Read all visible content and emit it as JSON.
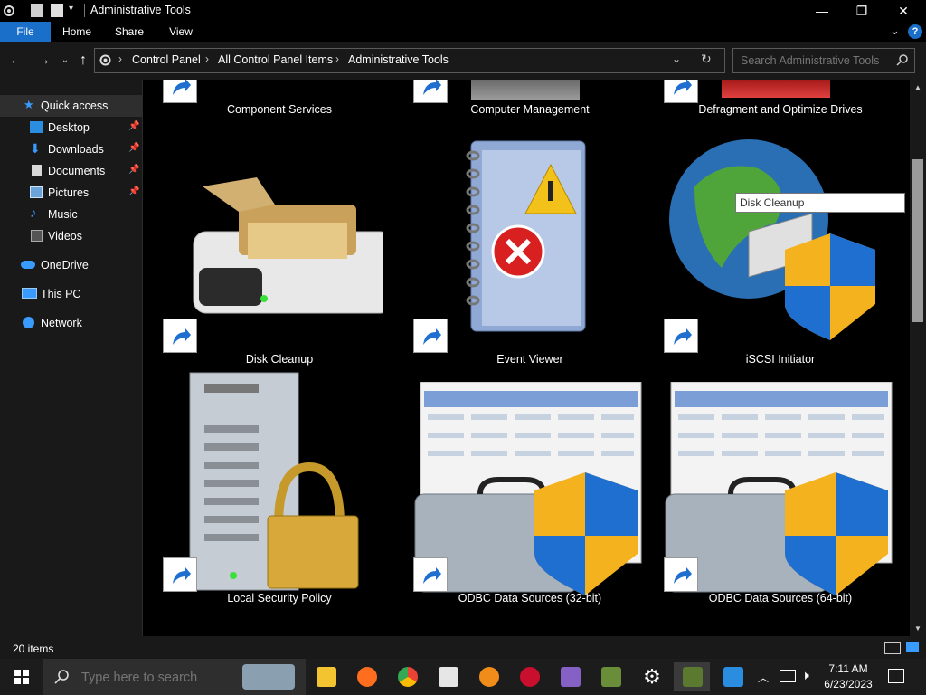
{
  "window": {
    "title": "Administrative Tools",
    "controls": [
      "minimize-icon",
      "maximize-icon",
      "close-icon"
    ]
  },
  "ribbon": {
    "tabs": [
      "File",
      "Home",
      "Share",
      "View"
    ]
  },
  "address": {
    "breadcrumbs": [
      "Control Panel",
      "All Control Panel Items",
      "Administrative Tools"
    ],
    "search_placeholder": "Search Administrative Tools"
  },
  "nav": {
    "quick_access": "Quick access",
    "items": [
      {
        "label": "Desktop",
        "icon": "desktop-icon",
        "pinned": true
      },
      {
        "label": "Downloads",
        "icon": "downloads-icon",
        "pinned": true
      },
      {
        "label": "Documents",
        "icon": "documents-icon",
        "pinned": true
      },
      {
        "label": "Pictures",
        "icon": "pictures-icon",
        "pinned": true
      },
      {
        "label": "Music",
        "icon": "music-icon",
        "pinned": false
      },
      {
        "label": "Videos",
        "icon": "videos-icon",
        "pinned": false
      }
    ],
    "onedrive": "OneDrive",
    "thispc": "This PC",
    "network": "Network"
  },
  "tiles": [
    {
      "label": "Component Services",
      "icon": "component-services-icon"
    },
    {
      "label": "Computer Management",
      "icon": "computer-management-icon"
    },
    {
      "label": "Defragment and Optimize Drives",
      "icon": "defragment-icon"
    },
    {
      "label": "Disk Cleanup",
      "icon": "disk-cleanup-icon"
    },
    {
      "label": "Event Viewer",
      "icon": "event-viewer-icon"
    },
    {
      "label": "iSCSI Initiator",
      "icon": "iscsi-initiator-icon"
    },
    {
      "label": "Local Security Policy",
      "icon": "local-security-policy-icon"
    },
    {
      "label": "ODBC Data Sources (32-bit)",
      "icon": "odbc-32-icon"
    },
    {
      "label": "ODBC Data Sources (64-bit)",
      "icon": "odbc-64-icon"
    }
  ],
  "tooltip": "Disk Cleanup",
  "status": {
    "items_count": "20 items"
  },
  "taskbar": {
    "search_placeholder": "Type here to search",
    "apps": [
      "file-explorer-icon",
      "firefox-icon",
      "chrome-icon",
      "paint-icon",
      "search-tool-icon",
      "devcpp-icon",
      "visual-studio-icon",
      "minecraft-icon",
      "settings-icon",
      "minecraft-launcher-icon",
      "remote-desktop-icon"
    ],
    "time": "7:11 AM",
    "date": "6/23/2023"
  },
  "colors": {
    "accent": "#1a6fc9",
    "background": "#191919",
    "content_bg": "#000000"
  }
}
